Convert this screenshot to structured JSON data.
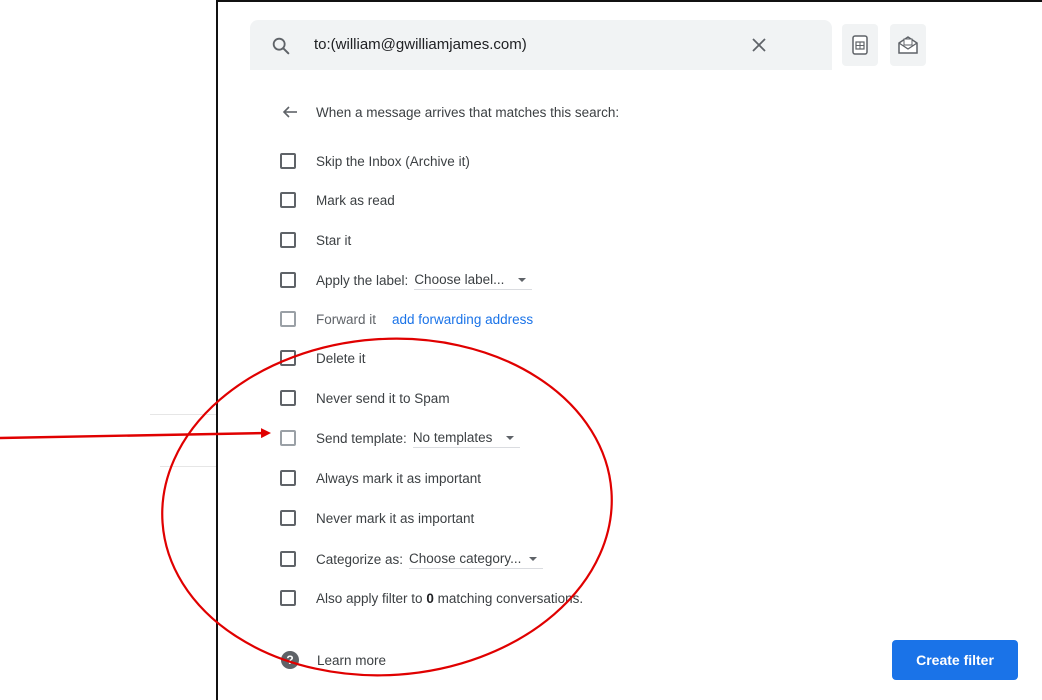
{
  "search": {
    "query": "to:(william@gwilliamjames.com)"
  },
  "header": {
    "text": "When a message arrives that matches this search:"
  },
  "options": {
    "skip_inbox": "Skip the Inbox (Archive it)",
    "mark_read": "Mark as read",
    "star": "Star it",
    "apply_label": "Apply the label:",
    "apply_label_select": "Choose label...",
    "forward": "Forward it",
    "forward_link": "add forwarding address",
    "delete": "Delete it",
    "never_spam": "Never send it to Spam",
    "send_template": "Send template:",
    "send_template_select": "No templates",
    "always_important": "Always mark it as important",
    "never_important": "Never mark it as important",
    "categorize": "Categorize as:",
    "categorize_select": "Choose category...",
    "also_apply_prefix": "Also apply filter to",
    "also_apply_count": "0",
    "also_apply_suffix": "matching conversations."
  },
  "footer": {
    "help_glyph": "?",
    "learn_more": "Learn more",
    "create_filter": "Create filter"
  },
  "icons": {
    "search": "search-icon",
    "clear": "close-icon",
    "tool1": "sheet-icon",
    "tool2": "envelope-icon",
    "back": "arrow-left-icon"
  },
  "colors": {
    "accent": "#1a73e8",
    "annotation": "#e00000"
  }
}
